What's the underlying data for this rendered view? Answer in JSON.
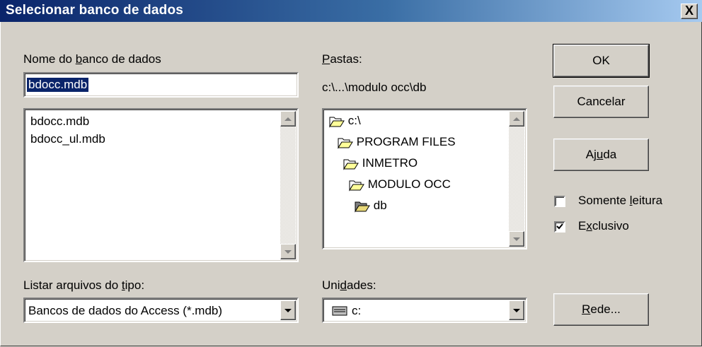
{
  "window": {
    "title": "Selecionar banco de dados",
    "close_glyph": "X"
  },
  "database": {
    "label_pre": "Nome do ",
    "label_u": "b",
    "label_post": "anco de dados",
    "value": "bdocc.mdb",
    "files": [
      "bdocc.mdb",
      "bdocc_ul.mdb"
    ]
  },
  "folders": {
    "label_u": "P",
    "label_post": "astas:",
    "path": "c:\\...\\modulo occ\\db",
    "items": [
      {
        "name": "c:\\",
        "icon": "open-folder-icon"
      },
      {
        "name": "PROGRAM FILES",
        "icon": "open-folder-icon"
      },
      {
        "name": "INMETRO",
        "icon": "open-folder-icon"
      },
      {
        "name": "MODULO OCC",
        "icon": "open-folder-icon"
      },
      {
        "name": "db",
        "icon": "current-folder-icon"
      }
    ]
  },
  "filetype": {
    "label_pre": "Listar arquivos do ",
    "label_u": "t",
    "label_post": "ipo:",
    "value": "Bancos de dados do Access (*.mdb)"
  },
  "drives": {
    "label_pre": "Uni",
    "label_u": "d",
    "label_post": "ades:",
    "value": "c:",
    "icon": "drive-icon"
  },
  "buttons": {
    "ok": "OK",
    "cancel": "Cancelar",
    "help_pre": "Aj",
    "help_u": "u",
    "help_post": "da",
    "network_u": "R",
    "network_post": "ede..."
  },
  "options": {
    "readonly_pre": "Somente ",
    "readonly_u": "l",
    "readonly_post": "eitura",
    "readonly_checked": false,
    "exclusive_pre": "E",
    "exclusive_u": "x",
    "exclusive_post": "clusivo",
    "exclusive_checked": true
  },
  "colors": {
    "face": "#d4d0c8",
    "title_start": "#0a246a",
    "title_end": "#a6caf0",
    "selection": "#0a246a"
  }
}
